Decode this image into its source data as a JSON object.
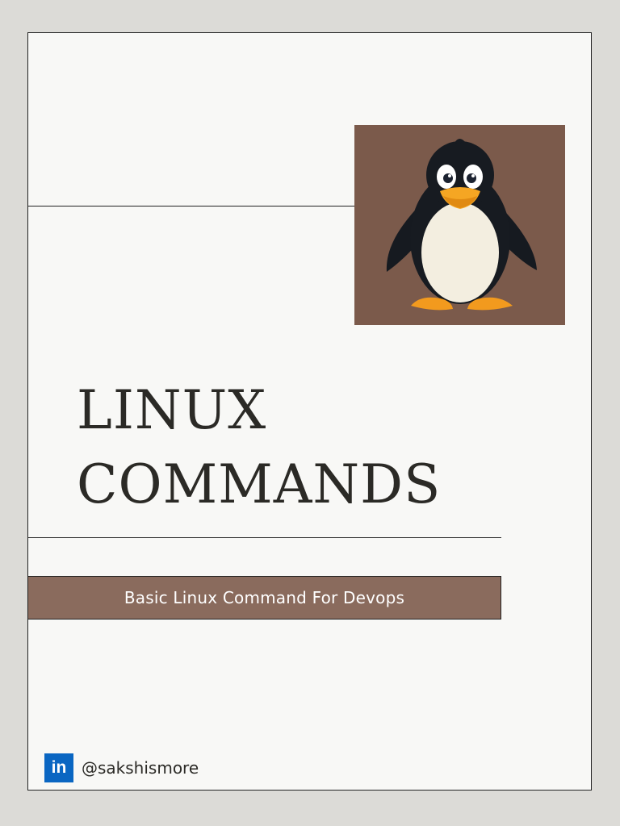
{
  "document": {
    "title_line1": "LINUX",
    "title_line2": "COMMANDS",
    "subtitle": "Basic Linux Command For Devops",
    "author_handle": "@sakshismore",
    "social_icon": "linkedin-icon",
    "social_icon_text": "in"
  },
  "illustration": {
    "name": "penguin-mascot",
    "background_color": "#7b5a4b"
  },
  "colors": {
    "page_background": "#f8f8f6",
    "outer_background": "#dcdbd7",
    "banner_background": "#8a6b5d",
    "text": "#2b2a26",
    "linkedin_blue": "#0a66c2"
  }
}
